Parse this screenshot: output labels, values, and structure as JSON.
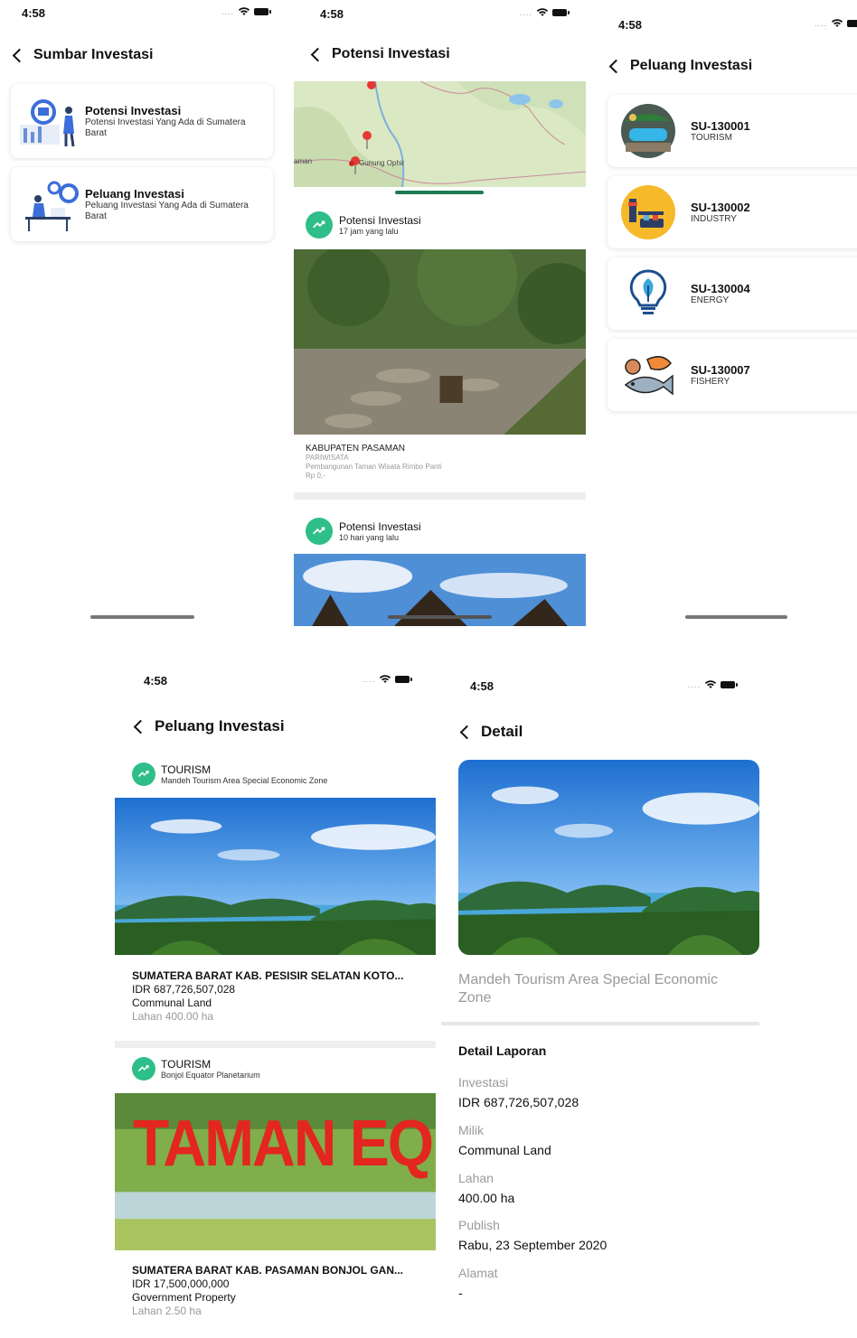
{
  "colors": {
    "accent": "#2dbe8a",
    "map_green": "#dbe8c4",
    "pin": "#e53935",
    "sky": "#3a8ee0"
  },
  "s1": {
    "time": "4:58",
    "title": "Sumbar Investasi",
    "cards": [
      {
        "title": "Potensi Investasi",
        "subtitle": "Potensi Investasi Yang Ada di Sumatera Barat"
      },
      {
        "title": "Peluang Investasi",
        "subtitle": "Peluang Investasi Yang Ada di Sumatera Barat"
      }
    ]
  },
  "s2": {
    "time": "4:58",
    "title": "Potensi Investasi",
    "map_labels": {
      "place": "Gunung Ophir",
      "edge": "aman"
    },
    "posts": [
      {
        "category": "Potensi Investasi",
        "time": "17 jam yang lalu",
        "region": "KABUPATEN PASAMAN",
        "sector": "PARIWISATA",
        "desc": "Pembangunan Taman Wisata Rimbo Panti",
        "price": "Rp 0,-"
      },
      {
        "category": "Potensi Investasi",
        "time": "10 hari yang lalu"
      }
    ]
  },
  "s3": {
    "time": "4:58",
    "title": "Peluang Investasi",
    "items": [
      {
        "code": "SU-130001",
        "sector": "TOURISM",
        "icon": "tourism-icon"
      },
      {
        "code": "SU-130002",
        "sector": "INDUSTRY",
        "icon": "industry-icon"
      },
      {
        "code": "SU-130004",
        "sector": "ENERGY",
        "icon": "energy-icon"
      },
      {
        "code": "SU-130007",
        "sector": "FISHERY",
        "icon": "fishery-icon"
      }
    ]
  },
  "s4": {
    "time": "4:58",
    "title": "Peluang Investasi",
    "posts": [
      {
        "sector": "TOURISM",
        "name": "Mandeh Tourism Area Special Economic Zone",
        "region": "SUMATERA BARAT KAB. PESISIR SELATAN KOTO...",
        "investment": "IDR 687,726,507,028",
        "ownership": "Communal Land",
        "area": "Lahan 400.00 ha"
      },
      {
        "sector": "TOURISM",
        "name": "Bonjol Equator Planetarium",
        "region": "SUMATERA BARAT KAB. PASAMAN BONJOL GAN...",
        "investment": "IDR 17,500,000,000",
        "ownership": "Government Property",
        "area": "Lahan 2.50 ha",
        "sign_text": "TAMAN EQUAT"
      }
    ]
  },
  "s5": {
    "time": "4:58",
    "title": "Detail",
    "caption": "Mandeh Tourism Area Special Economic Zone",
    "section": "Detail Laporan",
    "fields": [
      {
        "label": "Investasi",
        "value": "IDR 687,726,507,028"
      },
      {
        "label": "Milik",
        "value": "Communal Land"
      },
      {
        "label": "Lahan",
        "value": "400.00 ha"
      },
      {
        "label": "Publish",
        "value": "Rabu, 23 September 2020"
      },
      {
        "label": "Alamat",
        "value": "-"
      }
    ]
  }
}
